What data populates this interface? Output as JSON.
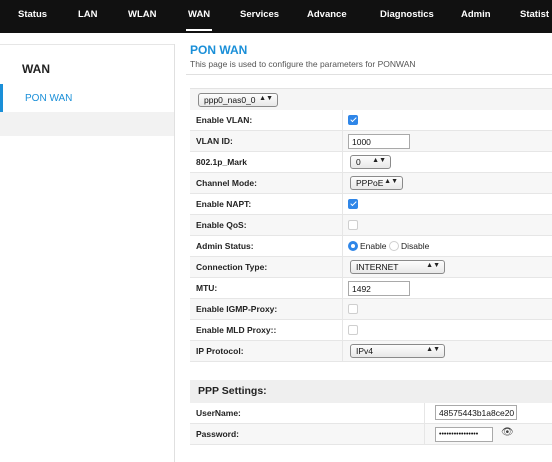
{
  "nav": {
    "tabs": [
      {
        "label": "Status"
      },
      {
        "label": "LAN"
      },
      {
        "label": "WLAN"
      },
      {
        "label": "WAN",
        "active": true
      },
      {
        "label": "Services"
      },
      {
        "label": "Advance"
      },
      {
        "label": "Diagnostics"
      },
      {
        "label": "Admin"
      },
      {
        "label": "Statist"
      }
    ]
  },
  "sidebar": {
    "title": "WAN",
    "items": [
      {
        "label": "PON WAN",
        "active": true
      }
    ]
  },
  "page": {
    "title": "PON WAN",
    "description": "This page is used to configure the parameters for PONWAN"
  },
  "connection_select": {
    "value": "ppp0_nas0_0"
  },
  "form": {
    "enable_vlan": {
      "label": "Enable VLAN:",
      "checked": true
    },
    "vlan_id": {
      "label": "VLAN ID:",
      "value": "1000"
    },
    "p_mark": {
      "label": "802.1p_Mark",
      "value": "0"
    },
    "channel_mode": {
      "label": "Channel Mode:",
      "value": "PPPoE"
    },
    "enable_napt": {
      "label": "Enable NAPT:",
      "checked": true
    },
    "enable_qos": {
      "label": "Enable QoS:",
      "checked": false
    },
    "admin_status": {
      "label": "Admin Status:",
      "enable_label": "Enable",
      "disable_label": "Disable",
      "selected": "Enable"
    },
    "connection_type": {
      "label": "Connection Type:",
      "value": "INTERNET"
    },
    "mtu": {
      "label": "MTU:",
      "value": "1492"
    },
    "igmp_proxy": {
      "label": "Enable IGMP-Proxy:",
      "checked": false
    },
    "mld_proxy": {
      "label": "Enable MLD Proxy::",
      "checked": false
    },
    "ip_protocol": {
      "label": "IP Protocol:",
      "value": "IPv4"
    }
  },
  "ppp": {
    "heading": "PPP Settings:",
    "username": {
      "label": "UserName:",
      "value": "48575443b1a8ce20"
    },
    "password": {
      "label": "Password:",
      "value": "••••••••••••••••"
    }
  },
  "colors": {
    "accent": "#1a8fd8",
    "checkbox": "#2f86e8",
    "nav_bg": "#111111"
  }
}
